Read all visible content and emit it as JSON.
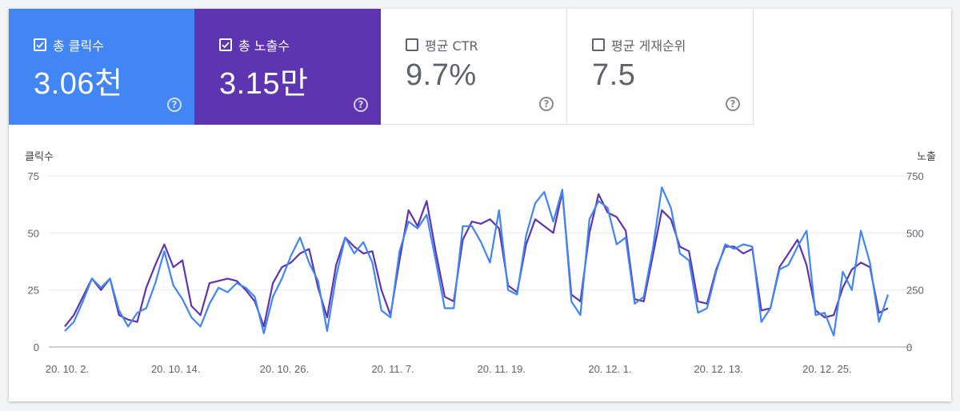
{
  "metrics": [
    {
      "label": "총 클릭수",
      "value": "3.06천",
      "checked": true,
      "color": "#4285f4"
    },
    {
      "label": "총 노출수",
      "value": "3.15만",
      "checked": true,
      "color": "#5e35b1"
    },
    {
      "label": "평균 CTR",
      "value": "9.7%",
      "checked": false,
      "color": "#ffffff"
    },
    {
      "label": "평균 게재순위",
      "value": "7.5",
      "checked": false,
      "color": "#ffffff"
    }
  ],
  "help_icon_glyph": "?",
  "chart_data": {
    "type": "line",
    "left_axis": {
      "title": "클릭수",
      "ticks": [
        "75",
        "50",
        "25",
        "0"
      ],
      "range": [
        0,
        75
      ]
    },
    "right_axis": {
      "title": "노출",
      "ticks": [
        "750",
        "500",
        "250",
        "0"
      ],
      "range": [
        0,
        750
      ]
    },
    "x_tick_labels": [
      "20. 10. 2.",
      "20. 10. 14.",
      "20. 10. 26.",
      "20. 11. 7.",
      "20. 11. 19.",
      "20. 12. 1.",
      "20. 12. 13.",
      "20. 12. 25."
    ],
    "series": [
      {
        "name": "클릭수",
        "axis": "left",
        "color": "#4285f4",
        "values": [
          7,
          11,
          20,
          30,
          26,
          30,
          16,
          9,
          15,
          17,
          28,
          42,
          27,
          21,
          13,
          9,
          19,
          26,
          24,
          28,
          26,
          22,
          6,
          22,
          30,
          40,
          48,
          37,
          29,
          7,
          31,
          48,
          41,
          46,
          37,
          16,
          13,
          42,
          55,
          52,
          58,
          38,
          17,
          17,
          53,
          53,
          46,
          37,
          60,
          25,
          23,
          49,
          63,
          68,
          55,
          69,
          20,
          14,
          56,
          64,
          61,
          45,
          48,
          19,
          22,
          43,
          70,
          61,
          41,
          38,
          15,
          17,
          33,
          45,
          43,
          45,
          44,
          11,
          17,
          34,
          36,
          44,
          51,
          14,
          15,
          5,
          33,
          25,
          51,
          37,
          11,
          23
        ]
      },
      {
        "name": "노출",
        "axis": "right",
        "color": "#5e35b1",
        "values": [
          90,
          140,
          220,
          300,
          250,
          300,
          140,
          120,
          110,
          260,
          360,
          450,
          350,
          380,
          180,
          140,
          280,
          290,
          300,
          290,
          250,
          200,
          90,
          280,
          350,
          370,
          410,
          430,
          260,
          130,
          360,
          480,
          440,
          410,
          420,
          250,
          140,
          380,
          600,
          530,
          640,
          420,
          220,
          200,
          470,
          550,
          540,
          560,
          520,
          270,
          240,
          450,
          560,
          530,
          500,
          680,
          230,
          200,
          500,
          670,
          590,
          570,
          510,
          210,
          200,
          400,
          600,
          560,
          440,
          420,
          200,
          190,
          340,
          440,
          440,
          410,
          430,
          160,
          170,
          350,
          410,
          470,
          360,
          160,
          130,
          140,
          260,
          340,
          370,
          350,
          150,
          170
        ]
      }
    ]
  }
}
